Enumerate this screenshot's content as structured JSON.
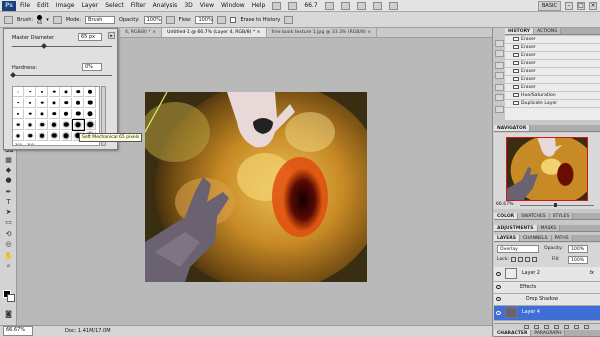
{
  "menubar": {
    "logo": "Ps",
    "items": [
      "File",
      "Edit",
      "Image",
      "Layer",
      "Select",
      "Filter",
      "Analysis",
      "3D",
      "View",
      "Window",
      "Help"
    ],
    "zoom": "66.7",
    "workspace": "BASIC"
  },
  "options": {
    "brush_label": "Brush:",
    "brush_size": "65",
    "mode_label": "Mode:",
    "mode_value": "Brush",
    "opacity_label": "Opacity:",
    "opacity_value": "100%",
    "flow_label": "Flow:",
    "flow_value": "100%",
    "erase_history": "Erase to History"
  },
  "doc_tabs": [
    "4, RGB/8) * ×",
    "Untitled-1 @ 66.7% (Layer 4, RGB/8) * ×",
    "free book texture 1.jpg @ 33.3% (RGB/8) ×"
  ],
  "brush_popup": {
    "master_diameter_label": "Master Diameter",
    "master_diameter_value": "65 px",
    "hardness_label": "Hardness:",
    "hardness_value": "0%",
    "size_labels": [
      "300",
      "300"
    ],
    "tooltip": "Soft Mechanical 65 pixels"
  },
  "status": {
    "zoom": "66.67%",
    "doc": "Doc: 1.41M/17.0M"
  },
  "history": {
    "tabs": [
      "HISTORY",
      "ACTIONS"
    ],
    "items": [
      "Eraser",
      "Eraser",
      "Eraser",
      "Eraser",
      "Eraser",
      "Eraser",
      "Eraser",
      "Hue/Saturation",
      "Duplicate Layer"
    ]
  },
  "navigator": {
    "tabs": [
      "NAVIGATOR"
    ],
    "zoom": "66.67%"
  },
  "color_tabs": [
    "COLOR",
    "SWATCHES",
    "STYLES"
  ],
  "adjust_tabs": [
    "ADJUSTMENTS",
    "MASKS"
  ],
  "layers": {
    "tabs": [
      "LAYERS",
      "CHANNELS",
      "PATHS"
    ],
    "blend_mode": "Overlay",
    "opacity_label": "Opacity:",
    "opacity_value": "100%",
    "lock_label": "Lock:",
    "fill_label": "Fill:",
    "fill_value": "100%",
    "rows": [
      {
        "name": "Layer 2",
        "fx": "fx"
      },
      {
        "name": "Effects"
      },
      {
        "name": "Drop Shadow"
      },
      {
        "name": "Layer 4"
      }
    ]
  },
  "bottom_tabs": [
    "CHARACTER",
    "PARAGRAPH"
  ],
  "colors": {
    "selection": "#3f6fd6",
    "app_bg": "#bdbdbd",
    "doc_bg": "#2e2510"
  }
}
